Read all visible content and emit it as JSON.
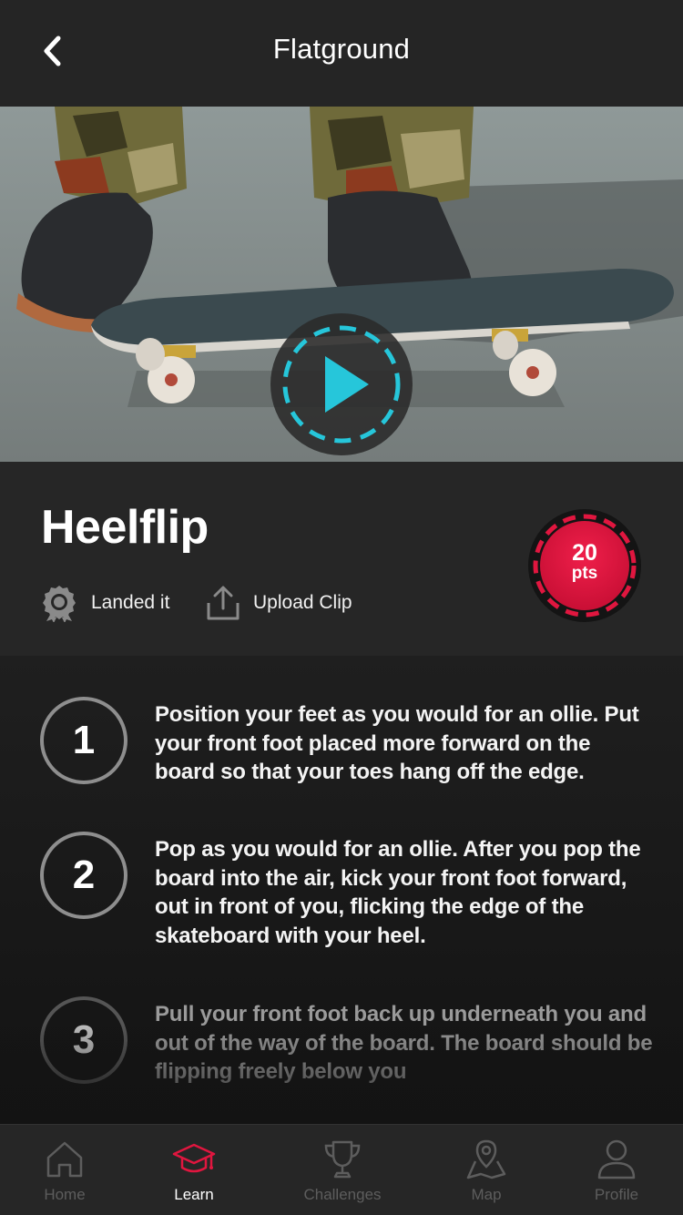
{
  "header": {
    "title": "Flatground",
    "back_icon": "chevron-left-icon"
  },
  "video": {
    "play_icon": "play-icon",
    "accent_color": "#26c6da"
  },
  "trick": {
    "name": "Heelflip",
    "actions": [
      {
        "label": "Landed it",
        "icon": "badge-icon"
      },
      {
        "label": "Upload Clip",
        "icon": "upload-icon"
      }
    ],
    "points": {
      "value": "20",
      "unit": "pts",
      "color": "#e0163f"
    }
  },
  "steps": [
    {
      "number": "1",
      "text": "Position your feet as you would for an ollie. Put your front foot placed more forward on the board so that your toes hang off the edge."
    },
    {
      "number": "2",
      "text": "Pop as you would for an ollie. After you pop the board into the air, kick your front foot forward, out in front of you, flicking the edge of the skateboard with your heel."
    },
    {
      "number": "3",
      "text": "Pull your front foot back up underneath you and out of the way of the board. The board should be flipping freely below you"
    }
  ],
  "tabbar": {
    "active_color": "#e0163f",
    "items": [
      {
        "label": "Home",
        "icon": "home-icon",
        "active": false
      },
      {
        "label": "Learn",
        "icon": "graduation-cap-icon",
        "active": true
      },
      {
        "label": "Challenges",
        "icon": "trophy-icon",
        "active": false
      },
      {
        "label": "Map",
        "icon": "map-icon",
        "active": false
      },
      {
        "label": "Profile",
        "icon": "profile-icon",
        "active": false
      }
    ]
  }
}
